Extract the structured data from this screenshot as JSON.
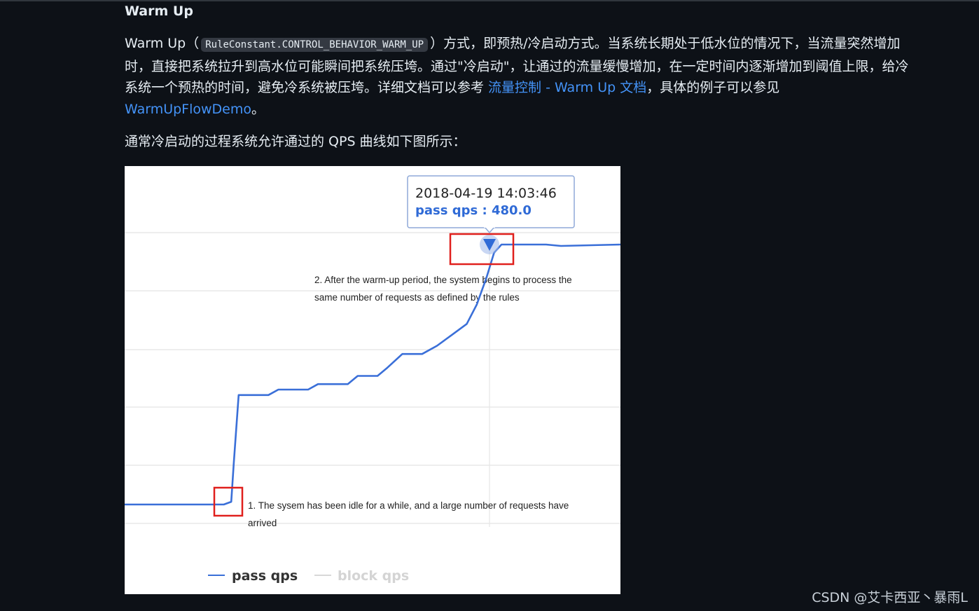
{
  "heading": "Warm Up",
  "paragraph": {
    "p1": "Warm Up（",
    "code": "RuleConstant.CONTROL_BEHAVIOR_WARM_UP",
    "p2": "）方式，即预热/冷启动方式。当系统长期处于低水位的情况下，当流量突然增加时，直接把系统拉升到高水位可能瞬间把系统压垮。通过\"冷启动\"，让通过的流量缓慢增加，在一定时间内逐渐增加到阈值上限，给冷系统一个预热的时间，避免冷系统被压垮。详细文档可以参考 ",
    "link1": "流量控制 - Warm Up 文档",
    "p3": "，具体的例子可以参见 ",
    "link2": "WarmUpFlowDemo",
    "p4": "。"
  },
  "paragraph2": "通常冷启动的过程系统允许通过的 QPS 曲线如下图所示：",
  "figure": {
    "tooltip_time": "2018-04-19 14:03:46",
    "tooltip_value": "pass qps : 480.0",
    "annotation1_line1": "1. The sysem has been idle for a while, and a large number of requests have",
    "annotation1_line2": "arrived",
    "annotation2_line1": "2. After the warm-up period, the system begins to process the",
    "annotation2_line2": "same number of requests as defined by the rules",
    "legend_pass": "pass qps",
    "legend_block": "block qps",
    "colors": {
      "pass": "#3a6fd8",
      "block": "#d8d8d8",
      "highlight": "#e0201d",
      "tooltip_value": "#2f6ad6"
    }
  },
  "chart_data": {
    "type": "line",
    "title": "",
    "series": [
      {
        "name": "pass qps",
        "points": [
          [
            0,
            0.05
          ],
          [
            0.2,
            0.05
          ],
          [
            0.215,
            0.06
          ],
          [
            0.22,
            0.2
          ],
          [
            0.23,
            0.45
          ],
          [
            0.29,
            0.45
          ],
          [
            0.31,
            0.47
          ],
          [
            0.37,
            0.47
          ],
          [
            0.39,
            0.49
          ],
          [
            0.45,
            0.49
          ],
          [
            0.47,
            0.52
          ],
          [
            0.51,
            0.52
          ],
          [
            0.53,
            0.55
          ],
          [
            0.56,
            0.6
          ],
          [
            0.6,
            0.6
          ],
          [
            0.63,
            0.63
          ],
          [
            0.66,
            0.67
          ],
          [
            0.69,
            0.71
          ],
          [
            0.71,
            0.78
          ],
          [
            0.73,
            0.88
          ],
          [
            0.745,
            0.97
          ],
          [
            0.76,
            1.0
          ],
          [
            0.8,
            1.0
          ],
          [
            0.85,
            1.0
          ],
          [
            0.88,
            0.995
          ],
          [
            1.0,
            1.0
          ]
        ]
      },
      {
        "name": "block qps",
        "points": []
      }
    ],
    "highlight_value": 480.0,
    "grid": true,
    "legend": "bottom-left"
  },
  "watermark": "CSDN @艾卡西亚丶暴雨L"
}
